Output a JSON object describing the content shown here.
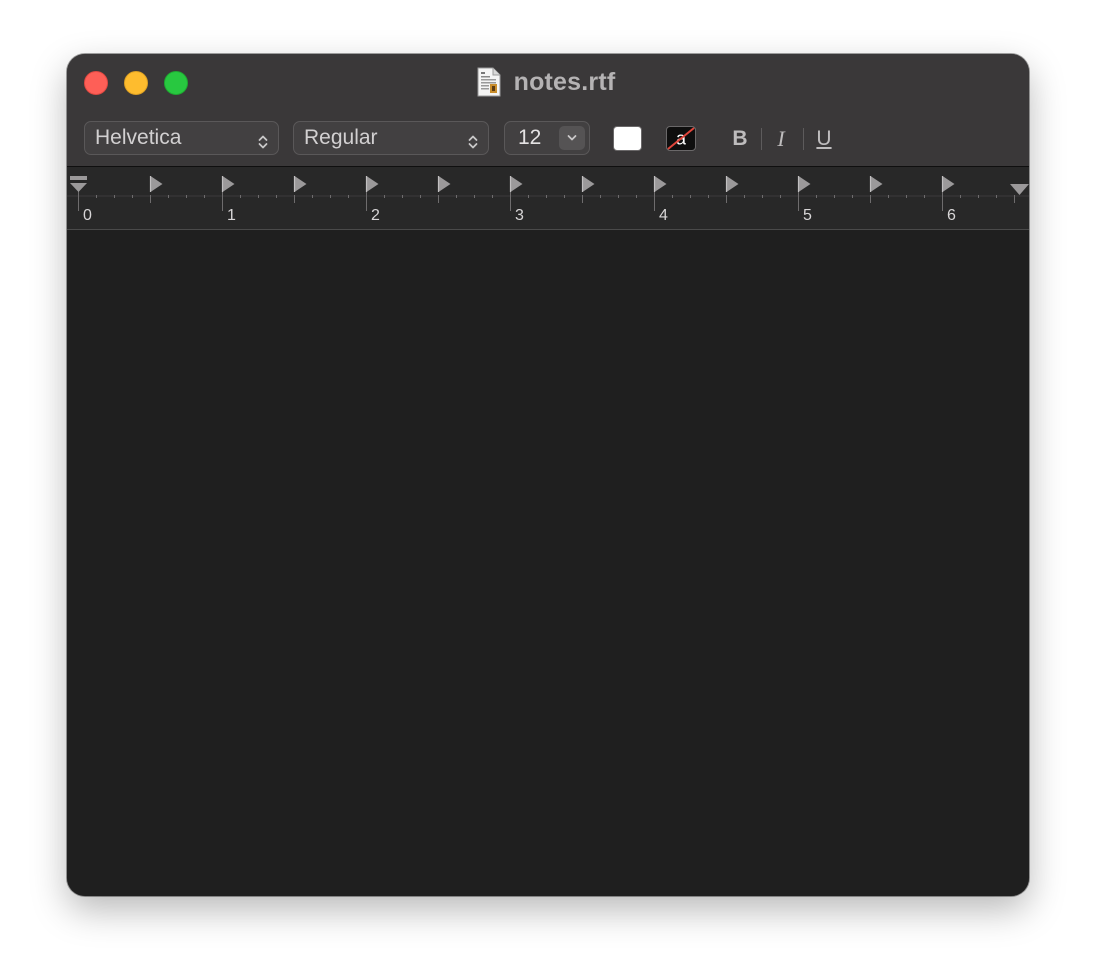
{
  "window": {
    "title": "notes.rtf"
  },
  "toolbar": {
    "font_family": "Helvetica",
    "font_style": "Regular",
    "font_size": "12",
    "bold_label": "B",
    "italic_label": "I",
    "underline_label": "U",
    "text_color": "#ffffff",
    "background_swatch_glyph": "a"
  },
  "ruler": {
    "labels": [
      "0",
      "1",
      "2",
      "3",
      "4",
      "5",
      "6"
    ],
    "unit": "inches"
  },
  "document": {
    "body_text": ""
  },
  "colors": {
    "close": "#fe5f57",
    "minimize": "#febc2e",
    "zoom": "#28c840",
    "titlebar": "#3a3839",
    "content": "#1f1f1f"
  },
  "icons": {
    "document": "rtf-document-icon",
    "popup_indicator": "up-down-chevron-icon",
    "stepper": "chevron-down-icon"
  }
}
